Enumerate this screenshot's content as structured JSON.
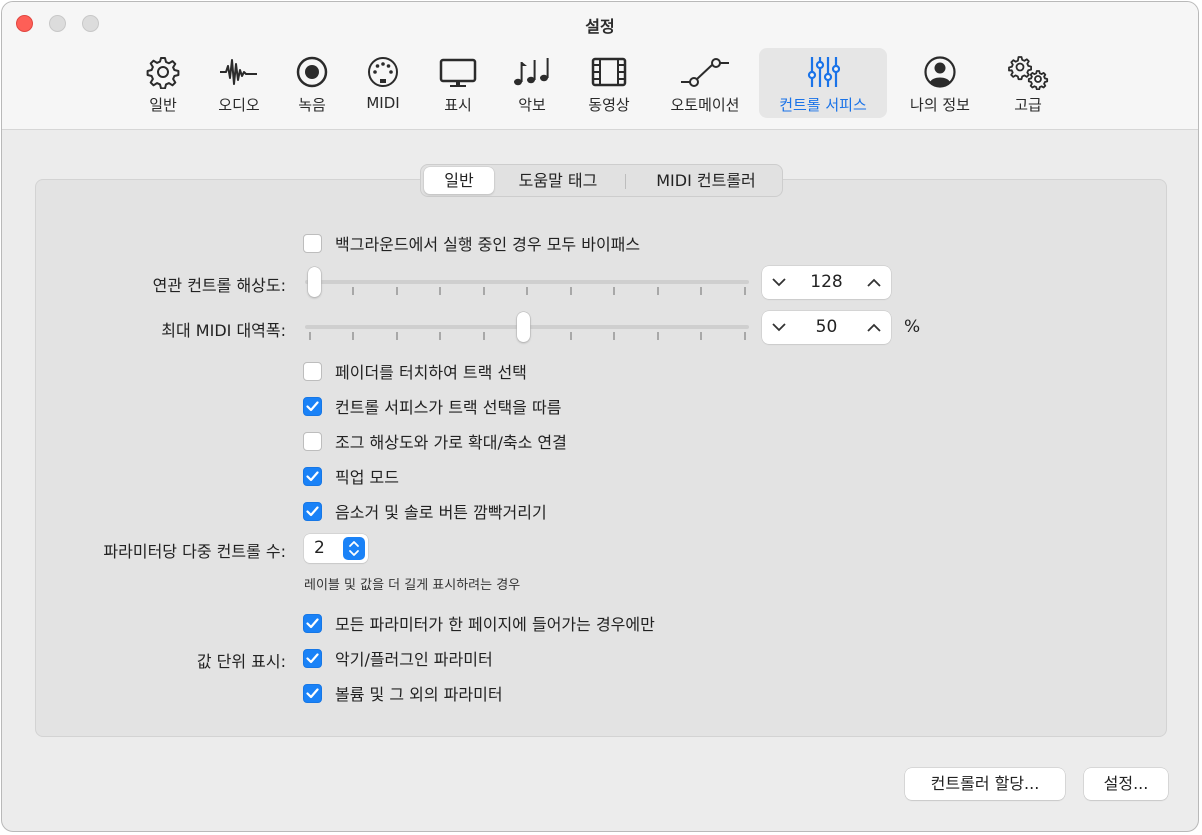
{
  "window": {
    "title": "설정"
  },
  "toolbar": {
    "tabs": [
      {
        "label": "일반",
        "icon": "gear-icon"
      },
      {
        "label": "오디오",
        "icon": "waveform-icon"
      },
      {
        "label": "녹음",
        "icon": "record-icon"
      },
      {
        "label": "MIDI",
        "icon": "midi-port-icon"
      },
      {
        "label": "표시",
        "icon": "display-icon"
      },
      {
        "label": "악보",
        "icon": "music-notes-icon"
      },
      {
        "label": "동영상",
        "icon": "film-icon"
      },
      {
        "label": "오토메이션",
        "icon": "automation-icon"
      },
      {
        "label": "컨트롤 서피스",
        "icon": "sliders-icon",
        "active": true
      },
      {
        "label": "나의 정보",
        "icon": "person-icon"
      },
      {
        "label": "고급",
        "icon": "gears-icon"
      }
    ]
  },
  "subtabs": [
    {
      "label": "일반",
      "active": true
    },
    {
      "label": "도움말 태그"
    },
    {
      "label": "MIDI 컨트롤러"
    }
  ],
  "settings": {
    "bypass_background": {
      "label": "백그라운드에서 실행 중인 경우 모두 바이패스",
      "checked": false
    },
    "related_resolution": {
      "label": "연관 컨트롤 해상도:",
      "value": "128",
      "slider_fraction": 0.0
    },
    "max_midi_bandwidth": {
      "label": "최대 MIDI 대역폭:",
      "value": "50",
      "unit": "%",
      "slider_fraction": 0.5
    },
    "fader_touch_select": {
      "label": "페이더를 터치하여 트랙 선택",
      "checked": false
    },
    "follow_track_selection": {
      "label": "컨트롤 서피스가 트랙 선택을 따름",
      "checked": true
    },
    "link_jog_zoom": {
      "label": "조그 해상도와 가로 확대/축소 연결",
      "checked": false
    },
    "pickup_mode": {
      "label": "픽업 모드",
      "checked": true
    },
    "blink_mute_solo": {
      "label": "음소거 및 솔로 버튼 깜빡거리기",
      "checked": true
    },
    "multi_controls": {
      "label": "파라미터당 다중 컨트롤 수:",
      "value": "2"
    },
    "longer_labels_note": "레이블 및 값을 더 길게 표시하려는 경우",
    "only_if_fit_page": {
      "label": "모든 파라미터가 한 페이지에 들어가는 경우에만",
      "checked": true
    },
    "value_units": {
      "label": "값 단위 표시:"
    },
    "instrument_plugin": {
      "label": "악기/플러그인 파라미터",
      "checked": true
    },
    "volume_other": {
      "label": "볼륨 및 그 외의 파라미터",
      "checked": true
    }
  },
  "buttons": {
    "controller_assign": "컨트롤러 할당...",
    "setup": "설정..."
  },
  "colors": {
    "accent": "#1a82f7",
    "close": "#fe5f57"
  }
}
